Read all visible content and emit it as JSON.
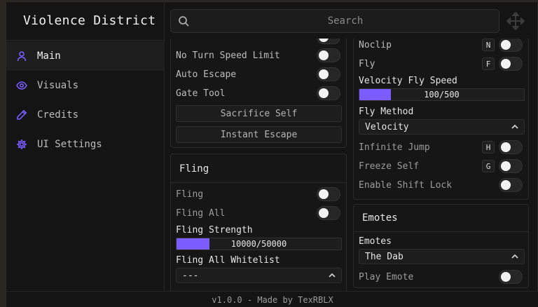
{
  "app": {
    "title": "Violence District",
    "version_text": "v1.0.0 - Made by TexRBLX"
  },
  "sidebar": {
    "items": [
      {
        "label": "Main",
        "icon": "user-icon",
        "active": true
      },
      {
        "label": "Visuals",
        "icon": "eye-icon",
        "active": false
      },
      {
        "label": "Credits",
        "icon": "pencil-icon",
        "active": false
      },
      {
        "label": "UI Settings",
        "icon": "gear-icon",
        "active": false
      }
    ]
  },
  "search": {
    "placeholder": "Search",
    "value": ""
  },
  "left_column": {
    "toggles": [
      {
        "label": "No Turn Speed Limit",
        "on": false
      },
      {
        "label": "Auto Escape",
        "on": false
      },
      {
        "label": "Gate Tool",
        "on": false
      }
    ],
    "buttons": [
      {
        "label": "Sacrifice Self"
      },
      {
        "label": "Instant Escape"
      }
    ],
    "fling": {
      "title": "Fling",
      "toggles": [
        {
          "label": "Fling",
          "on": false
        },
        {
          "label": "Fling All",
          "on": false
        }
      ],
      "slider": {
        "label": "Fling Strength",
        "value_text": "10000/50000",
        "fraction": 0.2
      },
      "dropdown": {
        "label": "Fling All Whitelist",
        "value": "---"
      }
    }
  },
  "right_column": {
    "movement": {
      "toggles_top": [
        {
          "label": "Noclip",
          "key": "N",
          "on": false
        },
        {
          "label": "Fly",
          "key": "F",
          "on": false
        }
      ],
      "slider": {
        "label": "Velocity Fly Speed",
        "value_text": "100/500",
        "fraction": 0.2
      },
      "dropdown": {
        "label": "Fly Method",
        "value": "Velocity"
      },
      "toggles_bottom": [
        {
          "label": "Infinite Jump",
          "key": "H",
          "on": false
        },
        {
          "label": "Freeze Self",
          "key": "G",
          "on": false
        },
        {
          "label": "Enable Shift Lock",
          "key": "",
          "on": false
        }
      ]
    },
    "emotes": {
      "title": "Emotes",
      "dropdown": {
        "label": "Emotes",
        "value": "The Dab"
      },
      "toggle": {
        "label": "Play Emote",
        "on": false
      }
    }
  },
  "colors": {
    "accent": "#7a5cff",
    "background": "#141414",
    "panel": "#161616"
  }
}
